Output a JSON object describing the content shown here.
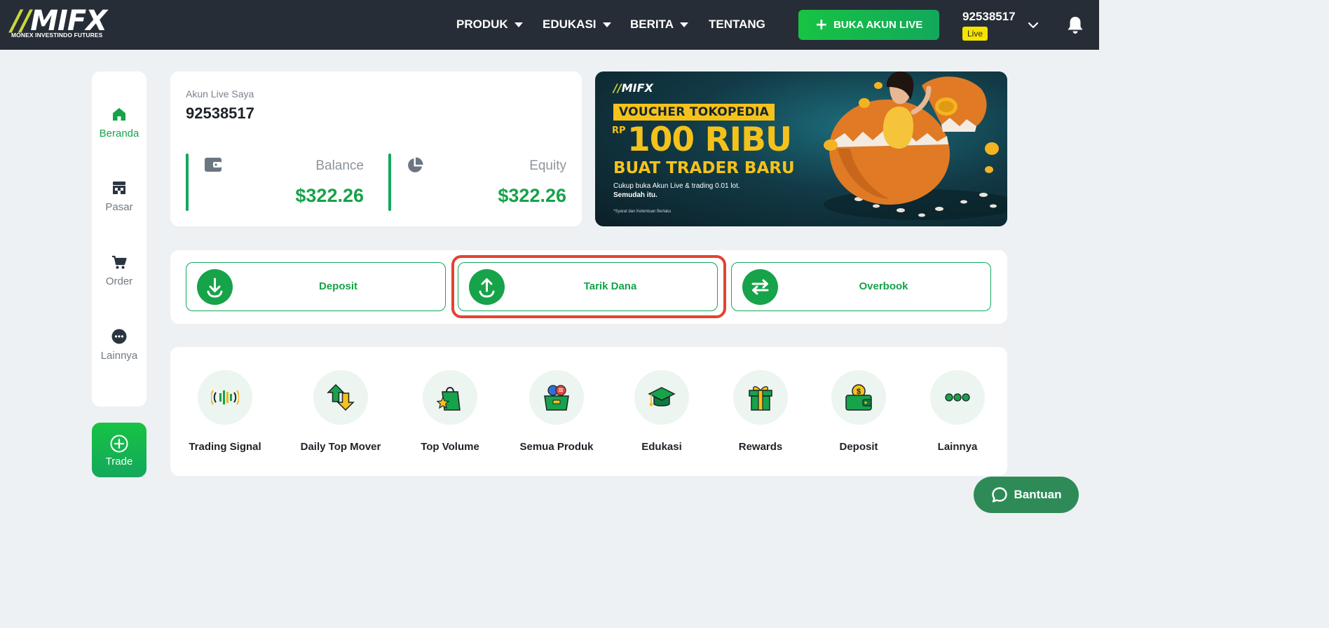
{
  "header": {
    "logo_text": "MIFX",
    "logo_subtitle": "MONEX INVESTINDO FUTURES",
    "nav": [
      {
        "label": "PRODUK",
        "dropdown": true
      },
      {
        "label": "EDUKASI",
        "dropdown": true
      },
      {
        "label": "BERITA",
        "dropdown": true
      },
      {
        "label": "TENTANG",
        "dropdown": false
      }
    ],
    "open_live_account": "BUKA AKUN LIVE",
    "account_number": "92538517",
    "account_type": "Live"
  },
  "sidebar": {
    "items": [
      {
        "label": "Beranda",
        "icon": "home-icon",
        "active": true
      },
      {
        "label": "Pasar",
        "icon": "store-icon",
        "active": false
      },
      {
        "label": "Order",
        "icon": "cart-icon",
        "active": false
      },
      {
        "label": "Lainnya",
        "icon": "more-icon",
        "active": false
      }
    ],
    "trade_label": "Trade"
  },
  "account_card": {
    "label": "Akun Live Saya",
    "number": "92538517",
    "balance_label": "Balance",
    "balance_value": "$322.26",
    "equity_label": "Equity",
    "equity_value": "$322.26"
  },
  "banner": {
    "logo": "MIFX",
    "voucher": "VOUCHER TOKOPEDIA",
    "currency": "RP",
    "amount": "100 RIBU",
    "tagline": "BUAT TRADER BARU",
    "desc_line1": "Cukup buka Akun Live & trading 0.01 lot.",
    "desc_line2": "Semudah itu.",
    "note": "*Syarat dan Ketentuan Berlaku"
  },
  "actions": [
    {
      "label": "Deposit",
      "icon": "download-icon"
    },
    {
      "label": "Tarik Dana",
      "icon": "upload-icon",
      "highlighted": true
    },
    {
      "label": "Overbook",
      "icon": "transfer-icon"
    }
  ],
  "shortcuts": [
    {
      "label": "Trading Signal",
      "icon": "signal-icon"
    },
    {
      "label": "Daily Top Mover",
      "icon": "updown-arrows-icon"
    },
    {
      "label": "Top Volume",
      "icon": "shopping-bag-icon"
    },
    {
      "label": "Semua Produk",
      "icon": "products-box-icon"
    },
    {
      "label": "Edukasi",
      "icon": "graduation-cap-icon"
    },
    {
      "label": "Rewards",
      "icon": "gift-icon"
    },
    {
      "label": "Deposit",
      "icon": "wallet-coin-icon"
    },
    {
      "label": "Lainnya",
      "icon": "more-dots-icon"
    }
  ],
  "help_button": "Bantuan",
  "colors": {
    "header_bg": "#262d36",
    "brand_green": "#16a34a",
    "highlight_red": "#e0442f",
    "page_bg": "#eef1f4"
  }
}
